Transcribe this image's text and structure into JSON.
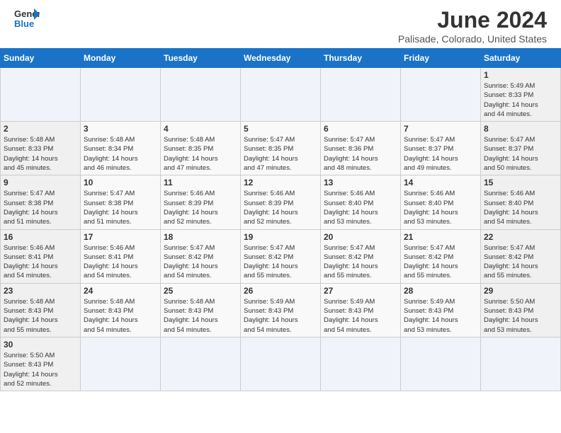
{
  "header": {
    "logo_general": "General",
    "logo_blue": "Blue",
    "month": "June 2024",
    "location": "Palisade, Colorado, United States"
  },
  "weekdays": [
    "Sunday",
    "Monday",
    "Tuesday",
    "Wednesday",
    "Thursday",
    "Friday",
    "Saturday"
  ],
  "weeks": [
    [
      {
        "day": "",
        "info": ""
      },
      {
        "day": "",
        "info": ""
      },
      {
        "day": "",
        "info": ""
      },
      {
        "day": "",
        "info": ""
      },
      {
        "day": "",
        "info": ""
      },
      {
        "day": "",
        "info": ""
      },
      {
        "day": "1",
        "info": "Sunrise: 5:49 AM\nSunset: 8:33 PM\nDaylight: 14 hours\nand 44 minutes."
      }
    ],
    [
      {
        "day": "2",
        "info": "Sunrise: 5:48 AM\nSunset: 8:33 PM\nDaylight: 14 hours\nand 45 minutes."
      },
      {
        "day": "3",
        "info": "Sunrise: 5:48 AM\nSunset: 8:34 PM\nDaylight: 14 hours\nand 46 minutes."
      },
      {
        "day": "4",
        "info": "Sunrise: 5:48 AM\nSunset: 8:35 PM\nDaylight: 14 hours\nand 47 minutes."
      },
      {
        "day": "5",
        "info": "Sunrise: 5:47 AM\nSunset: 8:35 PM\nDaylight: 14 hours\nand 47 minutes."
      },
      {
        "day": "6",
        "info": "Sunrise: 5:47 AM\nSunset: 8:36 PM\nDaylight: 14 hours\nand 48 minutes."
      },
      {
        "day": "7",
        "info": "Sunrise: 5:47 AM\nSunset: 8:37 PM\nDaylight: 14 hours\nand 49 minutes."
      },
      {
        "day": "8",
        "info": "Sunrise: 5:47 AM\nSunset: 8:37 PM\nDaylight: 14 hours\nand 50 minutes."
      }
    ],
    [
      {
        "day": "9",
        "info": "Sunrise: 5:47 AM\nSunset: 8:38 PM\nDaylight: 14 hours\nand 51 minutes."
      },
      {
        "day": "10",
        "info": "Sunrise: 5:47 AM\nSunset: 8:38 PM\nDaylight: 14 hours\nand 51 minutes."
      },
      {
        "day": "11",
        "info": "Sunrise: 5:46 AM\nSunset: 8:39 PM\nDaylight: 14 hours\nand 52 minutes."
      },
      {
        "day": "12",
        "info": "Sunrise: 5:46 AM\nSunset: 8:39 PM\nDaylight: 14 hours\nand 52 minutes."
      },
      {
        "day": "13",
        "info": "Sunrise: 5:46 AM\nSunset: 8:40 PM\nDaylight: 14 hours\nand 53 minutes."
      },
      {
        "day": "14",
        "info": "Sunrise: 5:46 AM\nSunset: 8:40 PM\nDaylight: 14 hours\nand 53 minutes."
      },
      {
        "day": "15",
        "info": "Sunrise: 5:46 AM\nSunset: 8:40 PM\nDaylight: 14 hours\nand 54 minutes."
      }
    ],
    [
      {
        "day": "16",
        "info": "Sunrise: 5:46 AM\nSunset: 8:41 PM\nDaylight: 14 hours\nand 54 minutes."
      },
      {
        "day": "17",
        "info": "Sunrise: 5:46 AM\nSunset: 8:41 PM\nDaylight: 14 hours\nand 54 minutes."
      },
      {
        "day": "18",
        "info": "Sunrise: 5:47 AM\nSunset: 8:42 PM\nDaylight: 14 hours\nand 54 minutes."
      },
      {
        "day": "19",
        "info": "Sunrise: 5:47 AM\nSunset: 8:42 PM\nDaylight: 14 hours\nand 55 minutes."
      },
      {
        "day": "20",
        "info": "Sunrise: 5:47 AM\nSunset: 8:42 PM\nDaylight: 14 hours\nand 55 minutes."
      },
      {
        "day": "21",
        "info": "Sunrise: 5:47 AM\nSunset: 8:42 PM\nDaylight: 14 hours\nand 55 minutes."
      },
      {
        "day": "22",
        "info": "Sunrise: 5:47 AM\nSunset: 8:42 PM\nDaylight: 14 hours\nand 55 minutes."
      }
    ],
    [
      {
        "day": "23",
        "info": "Sunrise: 5:48 AM\nSunset: 8:43 PM\nDaylight: 14 hours\nand 55 minutes."
      },
      {
        "day": "24",
        "info": "Sunrise: 5:48 AM\nSunset: 8:43 PM\nDaylight: 14 hours\nand 54 minutes."
      },
      {
        "day": "25",
        "info": "Sunrise: 5:48 AM\nSunset: 8:43 PM\nDaylight: 14 hours\nand 54 minutes."
      },
      {
        "day": "26",
        "info": "Sunrise: 5:49 AM\nSunset: 8:43 PM\nDaylight: 14 hours\nand 54 minutes."
      },
      {
        "day": "27",
        "info": "Sunrise: 5:49 AM\nSunset: 8:43 PM\nDaylight: 14 hours\nand 54 minutes."
      },
      {
        "day": "28",
        "info": "Sunrise: 5:49 AM\nSunset: 8:43 PM\nDaylight: 14 hours\nand 53 minutes."
      },
      {
        "day": "29",
        "info": "Sunrise: 5:50 AM\nSunset: 8:43 PM\nDaylight: 14 hours\nand 53 minutes."
      }
    ],
    [
      {
        "day": "30",
        "info": "Sunrise: 5:50 AM\nSunset: 8:43 PM\nDaylight: 14 hours\nand 52 minutes."
      },
      {
        "day": "",
        "info": ""
      },
      {
        "day": "",
        "info": ""
      },
      {
        "day": "",
        "info": ""
      },
      {
        "day": "",
        "info": ""
      },
      {
        "day": "",
        "info": ""
      },
      {
        "day": "",
        "info": ""
      }
    ]
  ]
}
